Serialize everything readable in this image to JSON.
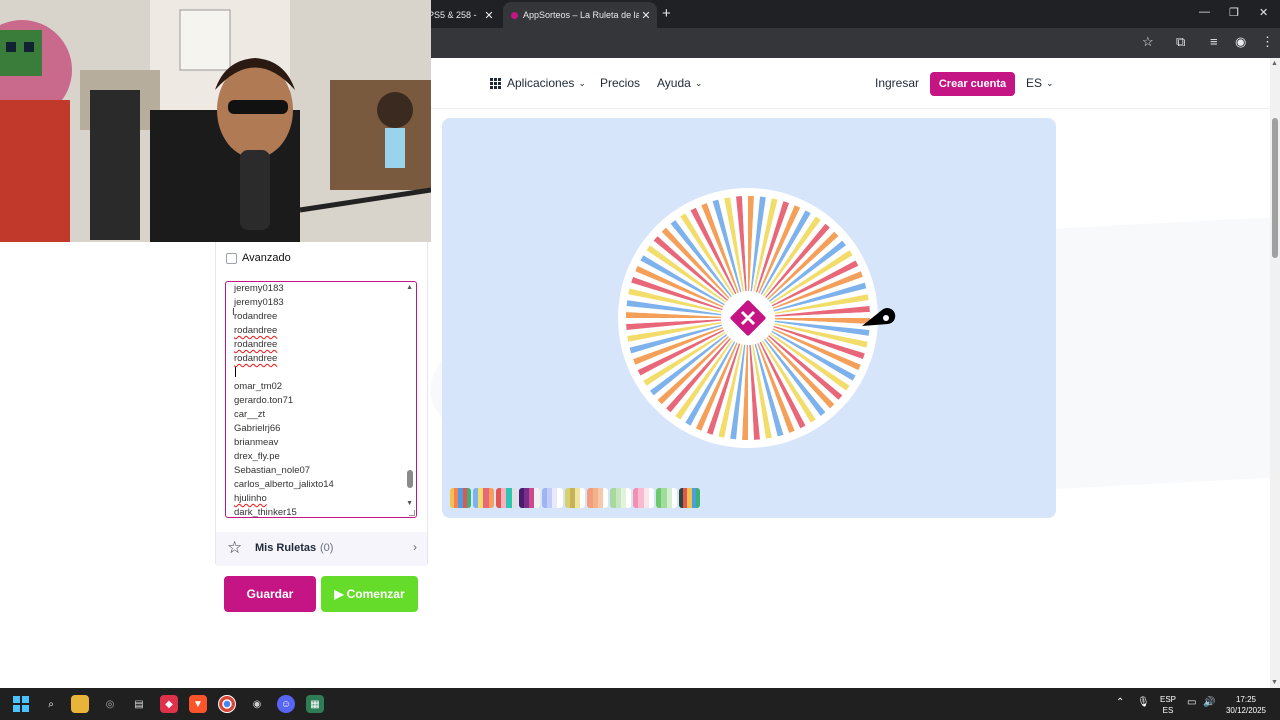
{
  "browser": {
    "tabs": [
      {
        "label": "PS5 & 258 -",
        "active": false
      },
      {
        "label": "AppSorteos – La Ruleta de la Su",
        "active": true
      }
    ],
    "new_tab": "+"
  },
  "nav": {
    "apps_label": "Aplicaciones",
    "prices_label": "Precios",
    "help_label": "Ayuda",
    "login_label": "Ingresar",
    "signup_label": "Crear cuenta",
    "lang_label": "ES"
  },
  "options": {
    "advanced_label": "Avanzado",
    "advanced_checked": false
  },
  "entries": {
    "lines": [
      {
        "text": "jeremy0183",
        "spell": false
      },
      {
        "text": "jeremy0183",
        "spell": false
      },
      {
        "text": "rodandree",
        "spell": false
      },
      {
        "text": "rodandree",
        "spell": true
      },
      {
        "text": "rodandree",
        "spell": true
      },
      {
        "text": "rodandree",
        "spell": true
      },
      {
        "text": "",
        "spell": false
      },
      {
        "text": "omar_tm02",
        "spell": false
      },
      {
        "text": "gerardo.ton71",
        "spell": false
      },
      {
        "text": "car__zt",
        "spell": false
      },
      {
        "text": "Gabrielrj66",
        "spell": false
      },
      {
        "text": "brianmeav",
        "spell": false
      },
      {
        "text": "drex_fly.pe",
        "spell": false
      },
      {
        "text": "Sebastian_nole07",
        "spell": false
      },
      {
        "text": "carlos_alberto_jalixto14",
        "spell": false
      },
      {
        "text": "hjulinho",
        "spell": true
      },
      {
        "text": "dark_thinker15",
        "spell": false
      }
    ]
  },
  "my_wheels": {
    "label": "Mis Ruletas",
    "count": "(0)"
  },
  "actions": {
    "save_label": "Guardar",
    "start_label": "Comenzar"
  },
  "wheel": {
    "segment_colors": [
      "#f4a05a",
      "#7eb2ec",
      "#f2dc6a",
      "#e8687a"
    ],
    "center_color": "#c51585"
  },
  "palettes": [
    [
      "#f2c14e",
      "#f78154",
      "#4d9de0",
      "#e15554",
      "#3bb273"
    ],
    [
      "#7eb2ec",
      "#f2dc6a",
      "#e8687a",
      "#f4a05a"
    ],
    [
      "#e15554",
      "#f7b2bd",
      "#2ec4b6",
      "#e0e0e0"
    ],
    [
      "#4a1c6b",
      "#7b2d8b",
      "#c94b8d",
      "#f2f2f2"
    ],
    [
      "#9fb4f0",
      "#c2cdf7",
      "#e6eafc",
      "#ffffff"
    ],
    [
      "#d8cf6e",
      "#c7b25a",
      "#eee6a0",
      "#ffffff"
    ],
    [
      "#f59c7c",
      "#f3b28b",
      "#f7c9a8",
      "#ffffff"
    ],
    [
      "#a8d8a0",
      "#c6e6bf",
      "#e2f2dd",
      "#ffffff"
    ],
    [
      "#f48fb1",
      "#f8bbd0",
      "#fce4ec",
      "#ffffff"
    ],
    [
      "#6ec96e",
      "#a0dc9c",
      "#d2f0d0",
      "#ffffff"
    ],
    [
      "#2b4a3b",
      "#e15554",
      "#f2c14e",
      "#4d9de0",
      "#3bb273"
    ]
  ],
  "taskbar": {
    "lang": "ESP",
    "lang_sub": "ES",
    "time": "17:25",
    "date": "30/12/2025"
  }
}
